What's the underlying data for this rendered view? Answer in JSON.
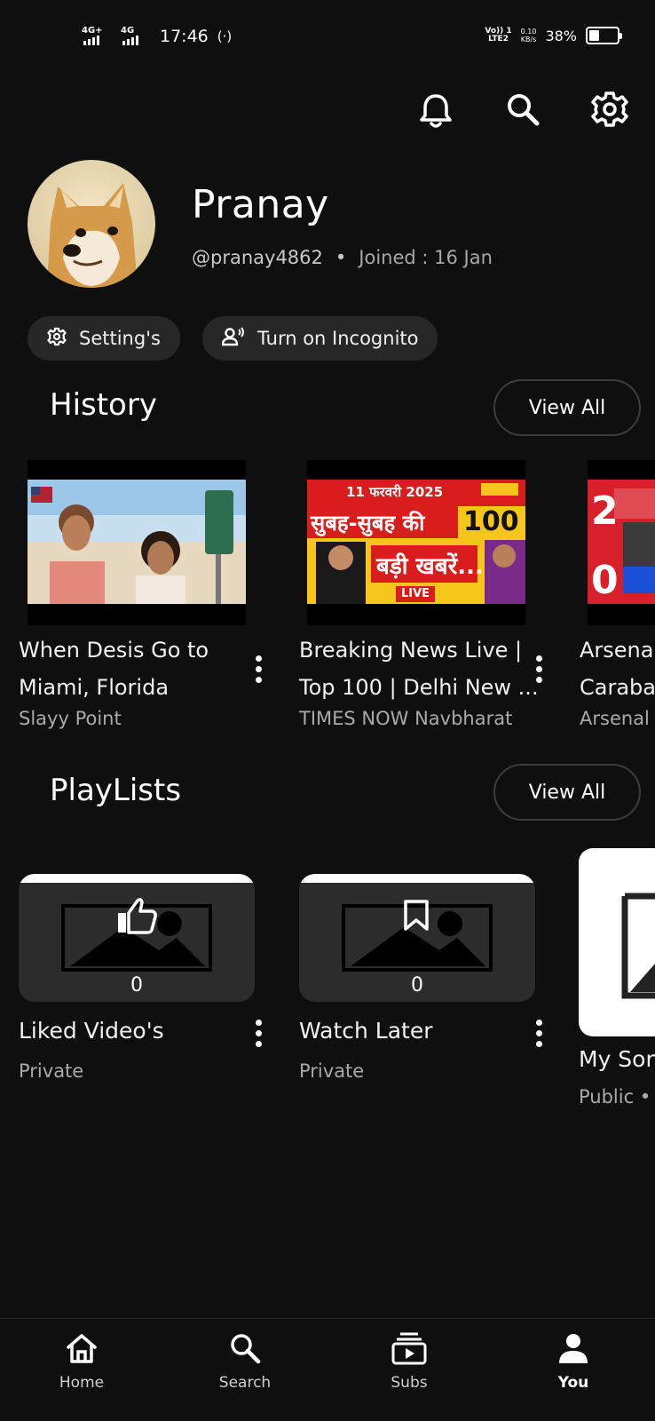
{
  "status_bar": {
    "net1": "4G+",
    "net2": "4G",
    "time": "17:46",
    "volte_top": "Vo)) 1",
    "volte_bottom": "LTE2",
    "speed_value": "0.10",
    "speed_unit": "KB/s",
    "battery": "38%",
    "battery_level": 0.38
  },
  "profile": {
    "name": "Pranay",
    "handle": "@pranay4862",
    "separator": "•",
    "joined": "Joined : 16 Jan"
  },
  "actions": {
    "settings_label": "Setting's",
    "incognito_label": "Turn on Incognito"
  },
  "history": {
    "title": "History",
    "view_all": "View All",
    "items": [
      {
        "title_line1": "When Desis Go to",
        "title_line2": "Miami, Florida",
        "channel": "Slayy Point"
      },
      {
        "title_line1": "Breaking News Live |",
        "title_line2": "Top 100 | Delhi New ...",
        "channel": "TIMES NOW Navbharat",
        "thumb_text_date": "11 फरवरी 2025",
        "thumb_text_line1": "सुबह-सुबह की",
        "thumb_text_100": "100",
        "thumb_text_line2": "बड़ी खबरें...",
        "thumb_text_live": "LIVE"
      },
      {
        "title_line1": "Arsenal",
        "title_line2": "Caraba",
        "channel": "Arsenal"
      }
    ]
  },
  "playlists": {
    "title": "PlayLists",
    "view_all": "View All",
    "items": [
      {
        "title": "Liked Video's",
        "subtitle": "Private",
        "count": "0"
      },
      {
        "title": "Watch Later",
        "subtitle": "Private",
        "count": "0"
      },
      {
        "title": "My Song",
        "subtitle": "Public • S"
      }
    ]
  },
  "nav": {
    "home": "Home",
    "search": "Search",
    "subs": "Subs",
    "you": "You"
  }
}
